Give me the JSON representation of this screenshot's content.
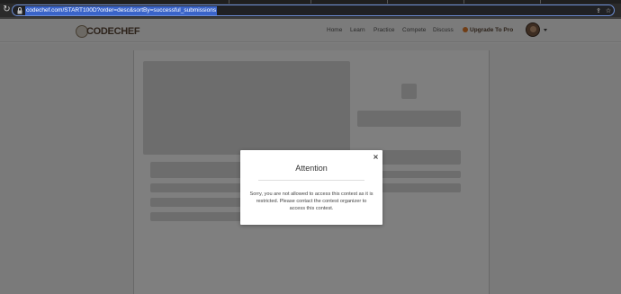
{
  "browser": {
    "url": "codechef.com/START100D?order=desc&sortBy=successful_submissions"
  },
  "header": {
    "logo_text": "CODECHEF",
    "nav": [
      "Home",
      "Learn",
      "Practice",
      "Compete",
      "Discuss"
    ],
    "upgrade_label": "Upgrade To Pro"
  },
  "modal": {
    "title": "Attention",
    "close_symbol": "×",
    "message": "Sorry, you are not allowed to access this contest as it is restricted. Please contact the contest organizer to access this contest."
  },
  "icons": {
    "reload": "reload-icon",
    "lock": "lock-icon",
    "share": "share-icon",
    "star": "star-icon"
  },
  "colors": {
    "overlay": "#000000",
    "brand": "#5b4636",
    "upgrade_accent": "#e07b2a",
    "address_highlight": "#3a64c9"
  }
}
